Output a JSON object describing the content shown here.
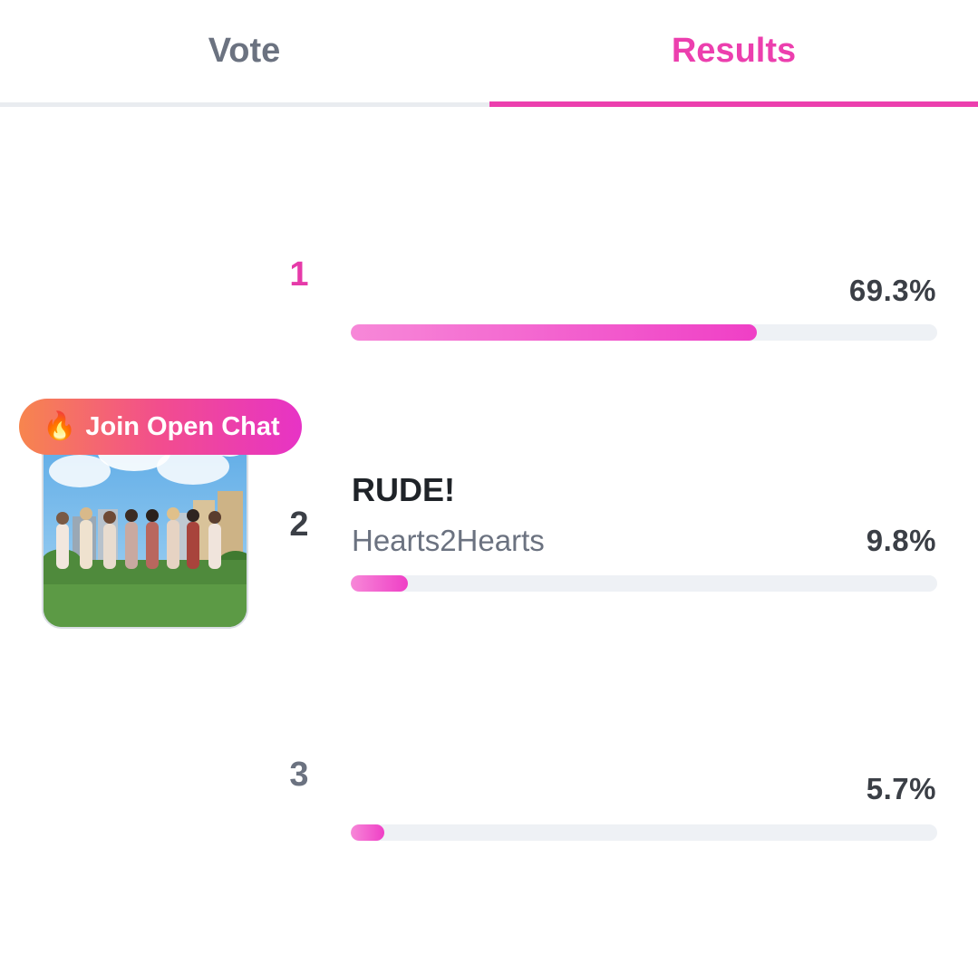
{
  "tabs": [
    {
      "label": "Vote",
      "active": false
    },
    {
      "label": "Results",
      "active": true
    }
  ],
  "accent_color": "#ec3fae",
  "rows": [
    {
      "rank": "1",
      "rank_color": "#e63aa9",
      "title": "",
      "artist": "",
      "percent_label": "69.3%",
      "percent": 69.3
    },
    {
      "rank": "2",
      "rank_color": "#3b3f46",
      "title": "RUDE!",
      "artist": "Hearts2Hearts",
      "percent_label": "9.8%",
      "percent": 9.8
    },
    {
      "rank": "3",
      "rank_color": "#6b7280",
      "title": "",
      "artist": "",
      "percent_label": "5.7%",
      "percent": 5.7
    }
  ],
  "open_chat": {
    "label": "Join Open Chat",
    "icon": "fire-icon"
  },
  "album_art": {
    "text": "RUDE!",
    "sky_color": "#6fb9ea",
    "grass_color": "#4f8a3c"
  }
}
